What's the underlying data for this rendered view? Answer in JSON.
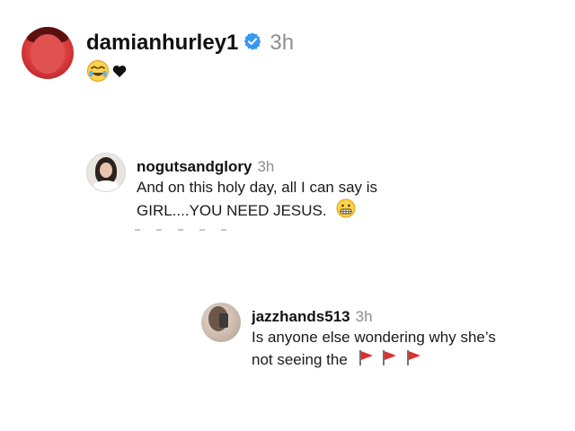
{
  "comments": [
    {
      "username": "damianhurley1",
      "verified": true,
      "time": "3h",
      "reaction_icons": [
        "face-with-tears-emoji",
        "black-heart-icon"
      ]
    },
    {
      "username": "nogutsandglory",
      "time": "3h",
      "lines": [
        "And on this holy day, all I can say is",
        "GIRL....YOU NEED JESUS."
      ],
      "emoji": "grimacing-face-emoji"
    },
    {
      "username": "jazzhands513",
      "time": "3h",
      "lines": [
        "Is anyone else wondering why she’s",
        "not seeing the"
      ],
      "emoji": "red-flag-emoji"
    }
  ],
  "colors": {
    "verified_blue": "#3897f0",
    "muted_text": "#8e8e8e",
    "flag_red": "#e0302d"
  }
}
